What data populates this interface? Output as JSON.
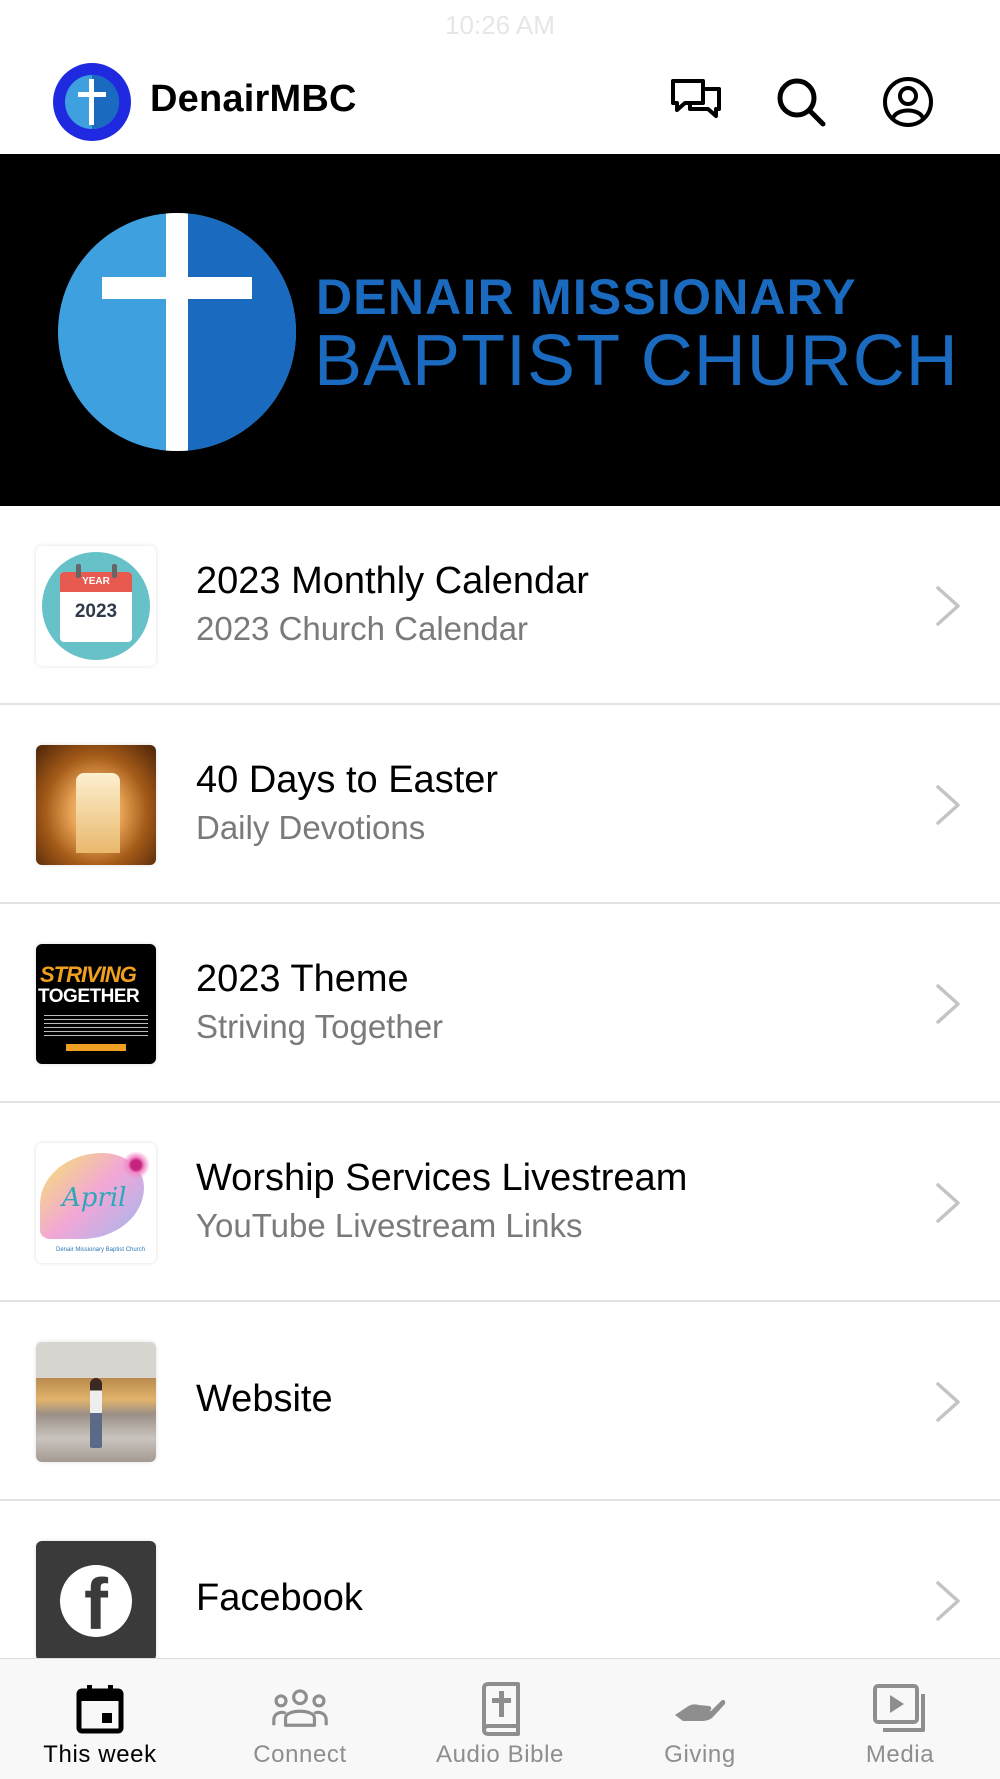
{
  "status_bar": {
    "time": "10:26 AM"
  },
  "header": {
    "app_name": "DenairMBC",
    "logo_icon": "cross-logo-icon",
    "actions": [
      {
        "name": "chat",
        "icon": "chat-bubbles-icon"
      },
      {
        "name": "search",
        "icon": "search-icon"
      },
      {
        "name": "profile",
        "icon": "user-circle-icon"
      }
    ]
  },
  "banner": {
    "line1": "DENAIR MISSIONARY",
    "line2": "BAPTIST CHURCH",
    "colors": {
      "background": "#000000",
      "text": "#1a6bc0",
      "circle_light": "#3ea0de",
      "circle_dark": "#1a6bc0"
    }
  },
  "items": [
    {
      "title": "2023 Monthly Calendar",
      "subtitle": "2023 Church Calendar",
      "thumb": "calendar-2023-thumbnail",
      "thumb_text": {
        "label": "YEAR",
        "year": "2023"
      }
    },
    {
      "title": "40 Days to Easter",
      "subtitle": "Daily Devotions",
      "thumb": "empty-tomb-thumbnail"
    },
    {
      "title": "2023 Theme",
      "subtitle": "Striving Together",
      "thumb": "striving-together-thumbnail",
      "thumb_text": {
        "line1": "STRIVING",
        "line2": "TOGETHER"
      }
    },
    {
      "title": "Worship Services Livestream",
      "subtitle": "YouTube Livestream Links",
      "thumb": "april-flyer-thumbnail",
      "thumb_text": {
        "word": "April",
        "caption": "Denair Missionary Baptist Church"
      }
    },
    {
      "title": "Website",
      "subtitle": "",
      "thumb": "train-station-thumbnail"
    },
    {
      "title": "Facebook",
      "subtitle": "",
      "thumb": "facebook-logo-thumbnail"
    }
  ],
  "tabs": [
    {
      "label": "This week",
      "icon": "calendar-icon",
      "active": true
    },
    {
      "label": "Connect",
      "icon": "people-group-icon",
      "active": false
    },
    {
      "label": "Audio Bible",
      "icon": "bible-icon",
      "active": false
    },
    {
      "label": "Giving",
      "icon": "giving-hand-icon",
      "active": false
    },
    {
      "label": "Media",
      "icon": "media-play-icon",
      "active": false
    }
  ],
  "colors": {
    "active_tab": "#000000",
    "inactive_tab": "#8e8e8e",
    "divider": "#e2e2e2",
    "subtitle": "#7a7a7a"
  }
}
